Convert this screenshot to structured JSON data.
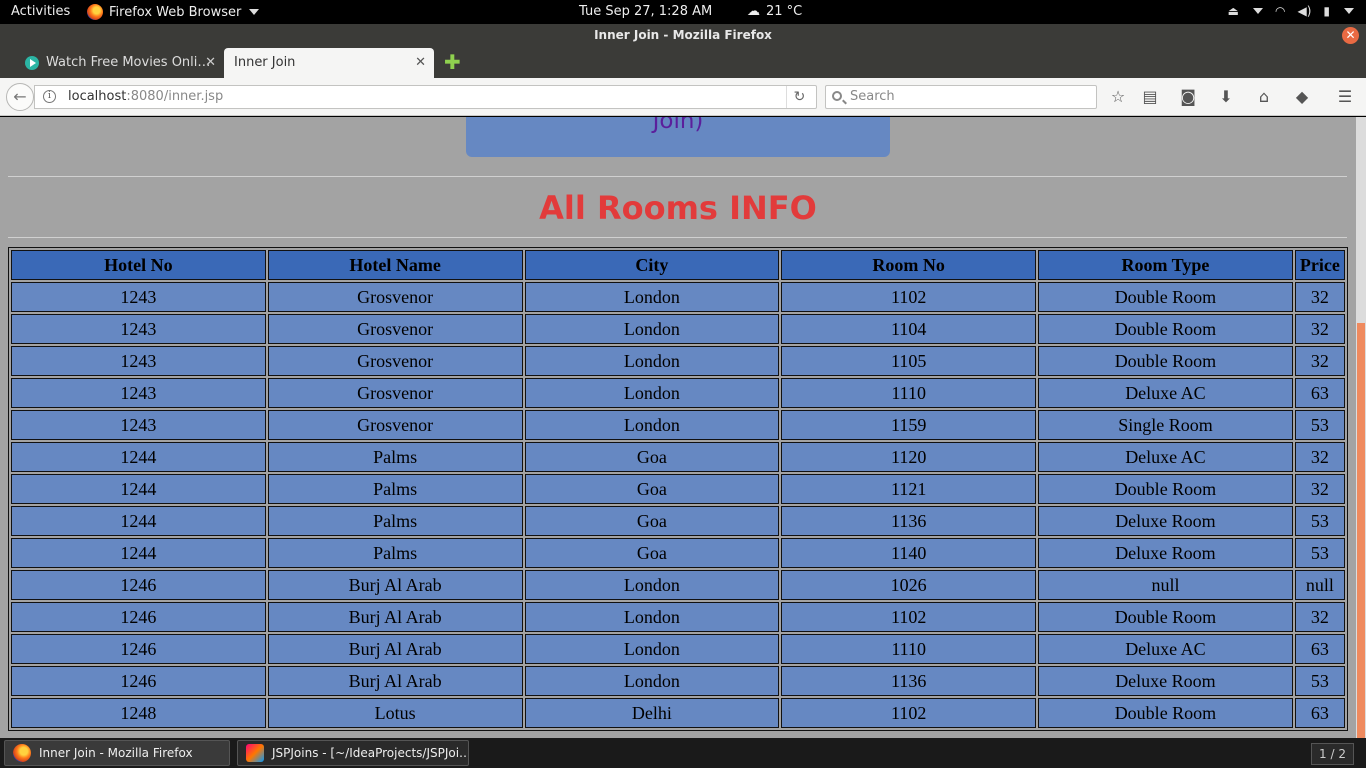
{
  "topbar": {
    "activities": "Activities",
    "app_menu": "Firefox Web Browser",
    "clock": "Tue Sep 27,  1:28 AM",
    "weather": "21 °C"
  },
  "window": {
    "title": "Inner Join - Mozilla Firefox"
  },
  "tabs": [
    {
      "label": "Watch Free Movies Onli…",
      "active": false
    },
    {
      "label": "Inner Join",
      "active": true
    }
  ],
  "navbar": {
    "url_host": "localhost",
    "url_rest": ":8080/inner.jsp",
    "search_placeholder": "Search"
  },
  "page": {
    "banner_text": "Join)",
    "heading": "All Rooms INFO",
    "table": {
      "headers": [
        "Hotel No",
        "Hotel Name",
        "City",
        "Room No",
        "Room Type",
        "Price"
      ],
      "rows": [
        [
          "1243",
          "Grosvenor",
          "London",
          "1102",
          "Double Room",
          "32"
        ],
        [
          "1243",
          "Grosvenor",
          "London",
          "1104",
          "Double Room",
          "32"
        ],
        [
          "1243",
          "Grosvenor",
          "London",
          "1105",
          "Double Room",
          "32"
        ],
        [
          "1243",
          "Grosvenor",
          "London",
          "1110",
          "Deluxe AC",
          "63"
        ],
        [
          "1243",
          "Grosvenor",
          "London",
          "1159",
          "Single Room",
          "53"
        ],
        [
          "1244",
          "Palms",
          "Goa",
          "1120",
          "Deluxe AC",
          "32"
        ],
        [
          "1244",
          "Palms",
          "Goa",
          "1121",
          "Double Room",
          "32"
        ],
        [
          "1244",
          "Palms",
          "Goa",
          "1136",
          "Deluxe Room",
          "53"
        ],
        [
          "1244",
          "Palms",
          "Goa",
          "1140",
          "Deluxe Room",
          "53"
        ],
        [
          "1246",
          "Burj Al Arab",
          "London",
          "1026",
          "null",
          "null"
        ],
        [
          "1246",
          "Burj Al Arab",
          "London",
          "1102",
          "Double Room",
          "32"
        ],
        [
          "1246",
          "Burj Al Arab",
          "London",
          "1110",
          "Deluxe AC",
          "63"
        ],
        [
          "1246",
          "Burj Al Arab",
          "London",
          "1136",
          "Deluxe Room",
          "53"
        ],
        [
          "1248",
          "Lotus",
          "Delhi",
          "1102",
          "Double Room",
          "63"
        ]
      ]
    }
  },
  "taskbar": {
    "items": [
      {
        "label": "Inner Join - Mozilla Firefox"
      },
      {
        "label": "JSPJoins - [~/IdeaProjects/JSPJoi…"
      }
    ],
    "pager": "1 / 2"
  },
  "colors": {
    "page_bg": "#a3a3a3",
    "table_header_bg": "#3a69b7",
    "table_cell_bg": "#6688c2",
    "heading": "#e23b3b",
    "banner_text": "#5b1f9c",
    "scroll_thumb": "#ef8a5e"
  }
}
